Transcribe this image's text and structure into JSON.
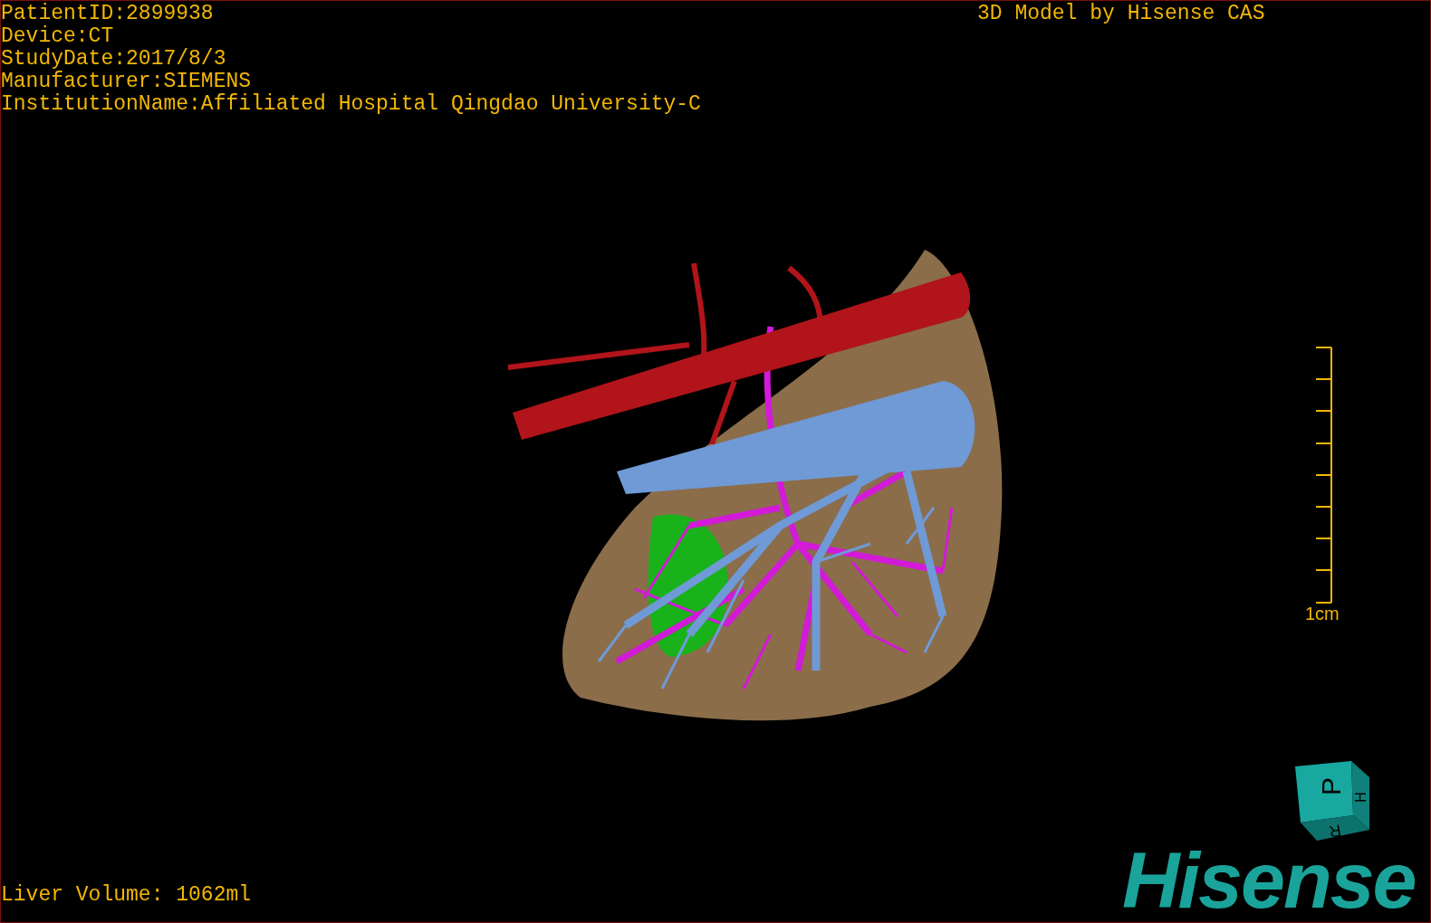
{
  "patient_info": [
    "PatientID:2899938",
    "Device:CT",
    "StudyDate:2017/8/3",
    "Manufacturer:SIEMENS",
    "InstitutionName:Affiliated Hospital Qingdao University-C"
  ],
  "caption": "3D Model by Hisense CAS",
  "scale_bar": {
    "label": "1cm"
  },
  "orientation_cube": {
    "front": "P",
    "side": "H",
    "bottom": "R"
  },
  "liver_volume": "Liver Volume: 1062ml",
  "logo": "Hisense"
}
